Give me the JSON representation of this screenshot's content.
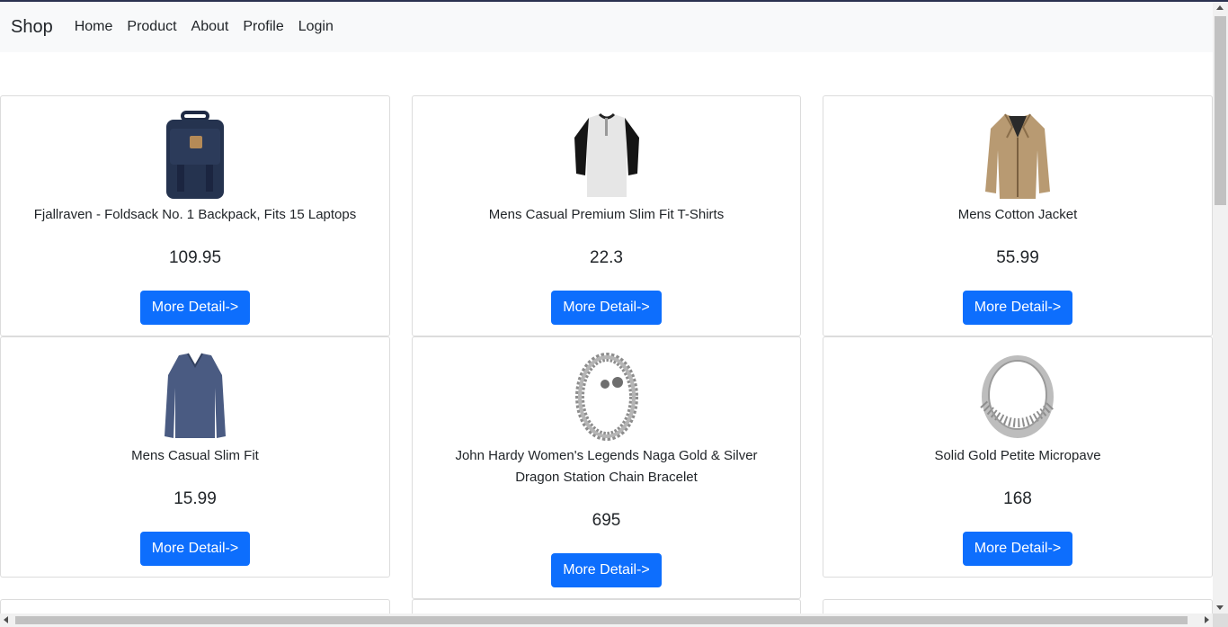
{
  "navbar": {
    "brand": "Shop",
    "links": [
      "Home",
      "Product",
      "About",
      "Profile",
      "Login"
    ]
  },
  "products": [
    {
      "title": "Fjallraven - Foldsack No. 1 Backpack, Fits 15 Laptops",
      "price": "109.95",
      "button": "More Detail->",
      "image": "backpack-image"
    },
    {
      "title": "Mens Casual Premium Slim Fit T-Shirts",
      "price": "22.3",
      "button": "More Detail->",
      "image": "tshirt-image"
    },
    {
      "title": "Mens Cotton Jacket",
      "price": "55.99",
      "button": "More Detail->",
      "image": "jacket-image"
    },
    {
      "title": "Mens Casual Slim Fit",
      "price": "15.99",
      "button": "More Detail->",
      "image": "sweater-image"
    },
    {
      "title": "John Hardy Women's Legends Naga Gold & Silver Dragon Station Chain Bracelet",
      "price": "695",
      "button": "More Detail->",
      "image": "bracelet-image"
    },
    {
      "title": "Solid Gold Petite Micropave",
      "price": "168",
      "button": "More Detail->",
      "image": "ring-image"
    }
  ],
  "colors": {
    "primary": "#0d6efd",
    "navbar_bg": "#f8f9fa"
  }
}
